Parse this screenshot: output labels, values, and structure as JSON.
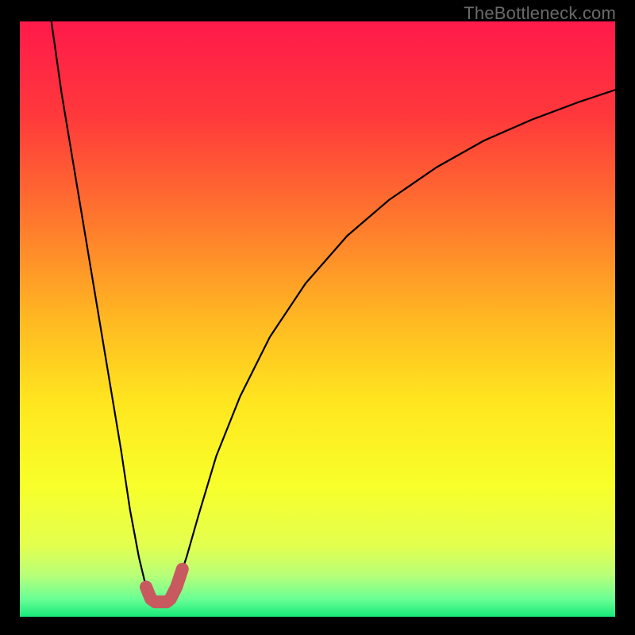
{
  "watermark": {
    "text": "TheBottleneck.com"
  },
  "gradient": {
    "stops": [
      {
        "offset": 0.0,
        "color": "#ff1a4a"
      },
      {
        "offset": 0.16,
        "color": "#ff393b"
      },
      {
        "offset": 0.34,
        "color": "#ff7a2d"
      },
      {
        "offset": 0.5,
        "color": "#ffb822"
      },
      {
        "offset": 0.64,
        "color": "#ffe61f"
      },
      {
        "offset": 0.78,
        "color": "#f8ff2a"
      },
      {
        "offset": 0.88,
        "color": "#e3ff4f"
      },
      {
        "offset": 0.93,
        "color": "#b8ff78"
      },
      {
        "offset": 0.97,
        "color": "#6aff95"
      },
      {
        "offset": 1.0,
        "color": "#18e879"
      }
    ]
  },
  "chart_data": {
    "type": "line",
    "title": "",
    "xlabel": "",
    "ylabel": "",
    "xlim": [
      0,
      100
    ],
    "ylim": [
      0,
      100
    ],
    "note": "x maps to 0–750px, y maps to 750–0px inside the plot box; values are approximate readings from the curve",
    "series": [
      {
        "name": "bottleneck-curve",
        "x": [
          5.3,
          7.0,
          9.0,
          11.0,
          13.0,
          15.0,
          17.0,
          18.5,
          20.0,
          21.2,
          22.0,
          22.7,
          23.3,
          24.0,
          24.7,
          25.3,
          26.3,
          28.0,
          30.0,
          33.0,
          37.0,
          42.0,
          48.0,
          55.0,
          62.0,
          70.0,
          78.0,
          86.0,
          94.0,
          100.0
        ],
        "y": [
          100.0,
          88.0,
          76.0,
          64.0,
          52.0,
          40.0,
          28.0,
          18.0,
          10.0,
          5.0,
          3.0,
          2.5,
          2.5,
          2.5,
          2.5,
          3.0,
          5.0,
          10.0,
          17.0,
          27.0,
          37.0,
          47.0,
          56.0,
          64.0,
          70.0,
          75.5,
          80.0,
          83.5,
          86.5,
          88.5
        ]
      },
      {
        "name": "bottom-highlight",
        "color": "#c8595e",
        "x": [
          21.2,
          22.0,
          22.7,
          23.3,
          24.0,
          24.7,
          25.3,
          26.3,
          27.3
        ],
        "y": [
          5.0,
          3.0,
          2.5,
          2.5,
          2.5,
          2.5,
          3.0,
          5.0,
          8.0
        ]
      }
    ]
  }
}
